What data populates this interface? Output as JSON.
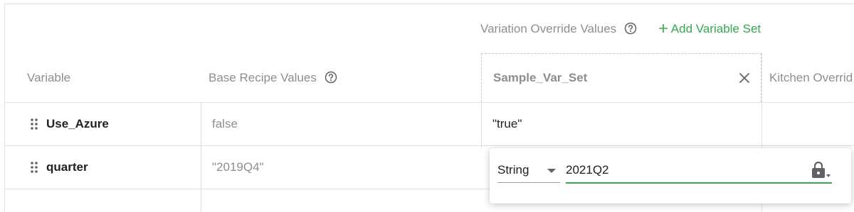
{
  "header": {
    "variation_override_label": "Variation Override Values",
    "add_variable_set_label": "Add Variable Set"
  },
  "columns": {
    "variable": "Variable",
    "base_recipe_values": "Base Recipe Values",
    "variable_set_name": "Sample_Var_Set",
    "kitchen_override": "Kitchen Overrid"
  },
  "rows": [
    {
      "name": "Use_Azure",
      "base_value": "false",
      "override_value": "\"true\""
    },
    {
      "name": "quarter",
      "base_value": "\"2019Q4\"",
      "override_value": ""
    }
  ],
  "editor": {
    "type_value": "String",
    "value": "2021Q2"
  },
  "colors": {
    "accent_green": "#34a853",
    "muted_text": "#8a8f94",
    "border": "#e0e0e0"
  }
}
